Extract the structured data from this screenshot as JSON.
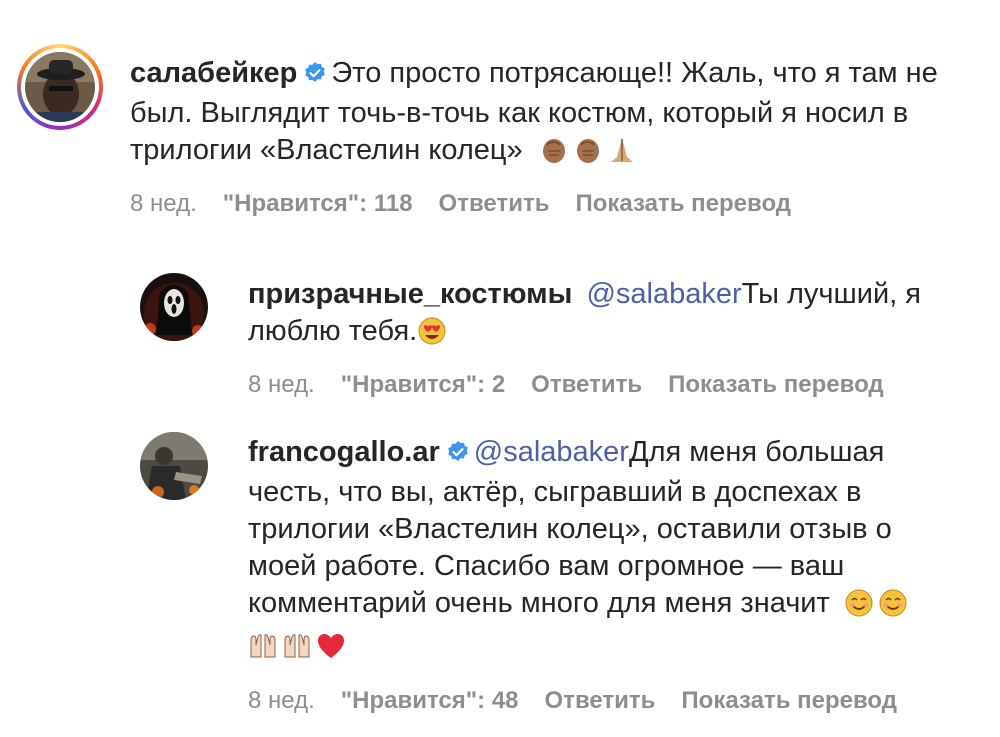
{
  "comments": [
    {
      "username": "салабейкер",
      "text": "Это просто потрясающе!! Жаль, что я там не был. Выглядит точь-в-точь как костюм, который я носил в трилогии «Властелин колец»",
      "line1": "Это просто потрясающе!! Жаль, что я там не",
      "line2": "был. Выглядит точь-в-точь как костюм, который я носил в",
      "line3": "трилогии «Властелин колец»",
      "time": "8 нед.",
      "likes": "\"Нравится\": 118",
      "reply": "Ответить",
      "translate": "Показать перевод",
      "emojis": [
        "clapping-hands-medium-dark",
        "clapping-hands-medium-dark",
        "folded-hands"
      ]
    }
  ],
  "replies": [
    {
      "username": "призрачные_костюмы",
      "mention": "@salabaker",
      "line1": "Ты лучший, я",
      "line2": "люблю тебя.",
      "time": "8 нед.",
      "likes": "\"Нравится\": 2",
      "reply": "Ответить",
      "translate": "Показать перевод",
      "emojis": [
        "heart-eyes"
      ]
    },
    {
      "username": "francogallo.ar",
      "mention": "@salabaker",
      "line1": "Для меня большая",
      "line2": "честь, что вы, актёр, сыгравший в доспехах в",
      "line3": "трилогии «Властелин колец», оставили отзыв о",
      "line4": "моей работе. Спасибо вам огромное — ваш",
      "line5": "комментарий очень много для меня значит",
      "time": "8 нед.",
      "likes": "\"Нравится\": 48",
      "reply": "Ответить",
      "translate": "Показать перевод",
      "emojis": [
        "smiling-face",
        "smiling-face",
        "raising-hands",
        "raising-hands",
        "red-heart"
      ]
    }
  ],
  "colors": {
    "mention": "#4e5fa8",
    "verified": "#3897f0",
    "meta": "#8e8e8e"
  }
}
